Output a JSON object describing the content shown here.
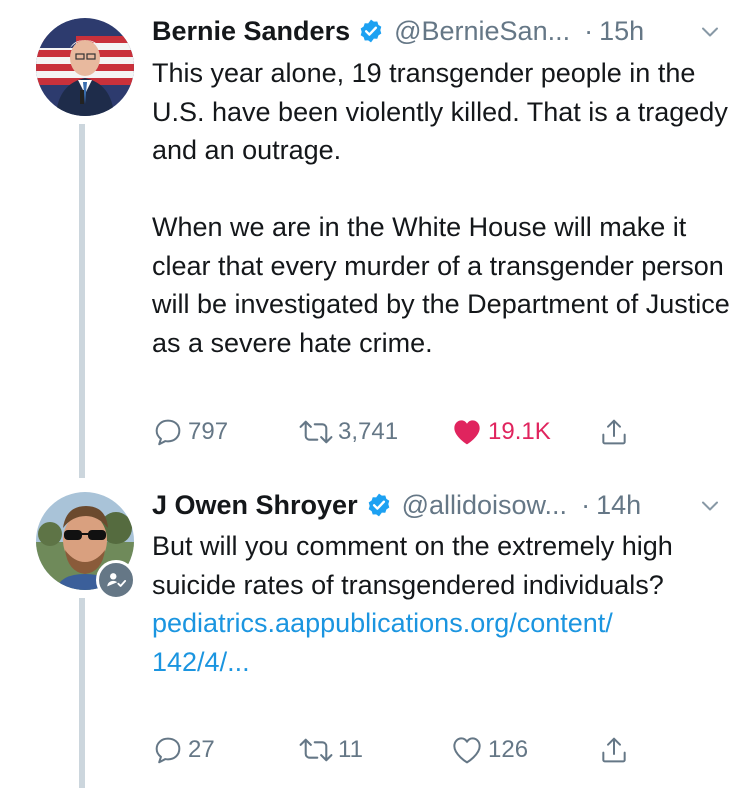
{
  "tweets": [
    {
      "name": "Bernie Sanders",
      "handle": "@BernieSan...",
      "dot": "·",
      "time": "15h",
      "paragraphs": [
        "This year alone, 19 transgender people in the U.S. have been violently killed. That is a tragedy and an outrage.",
        "When we are in the White House will make it clear that every murder of a transgender person will be investigated by the Department of Justice as a severe hate crime."
      ],
      "replies": "797",
      "retweets": "3,741",
      "likes": "19.1K",
      "liked": true
    },
    {
      "name": "J Owen Shroyer",
      "handle": "@allidoisow...",
      "dot": "·",
      "time": "14h",
      "paragraphs": [
        "But will you comment on the extremely high suicide rates of transgendered individuals?"
      ],
      "link_line1": "pediatrics.aappublications.org/content/",
      "link_line2": "142/4/...",
      "replies": "27",
      "retweets": "11",
      "likes": "126",
      "liked": false
    }
  ],
  "colors": {
    "verified": "#1da1f2",
    "link": "#1b95e0",
    "like_active": "#e0245e",
    "muted": "#657786",
    "thread_line": "#ccd6dd"
  },
  "icons": [
    "verified-badge-icon",
    "chevron-down-icon",
    "reply-icon",
    "retweet-icon",
    "heart-icon",
    "share-icon",
    "follow-badge-icon"
  ]
}
